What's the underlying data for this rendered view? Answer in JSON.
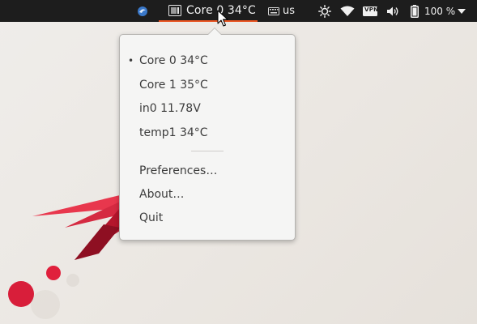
{
  "topbar": {
    "sensor_indicator": {
      "label": "Core 0 34°C",
      "icon": "sensor-chip-icon"
    },
    "keyboard_indicator": {
      "label": "us",
      "icon": "keyboard-icon"
    },
    "battery_indicator": {
      "label": "100 %",
      "icon": "battery-icon"
    },
    "vpn_indicator": {
      "label": "VPN"
    },
    "accent_color": "#e95420"
  },
  "menu": {
    "items": [
      {
        "label": "Core 0 34°C",
        "selected": true
      },
      {
        "label": "Core 1 35°C",
        "selected": false
      },
      {
        "label": "in0 11.78V",
        "selected": false
      },
      {
        "label": "temp1 34°C",
        "selected": false
      }
    ],
    "actions": [
      {
        "label": "Preferences…"
      },
      {
        "label": "About…"
      },
      {
        "label": "Quit"
      }
    ],
    "selected_marker": "•"
  }
}
